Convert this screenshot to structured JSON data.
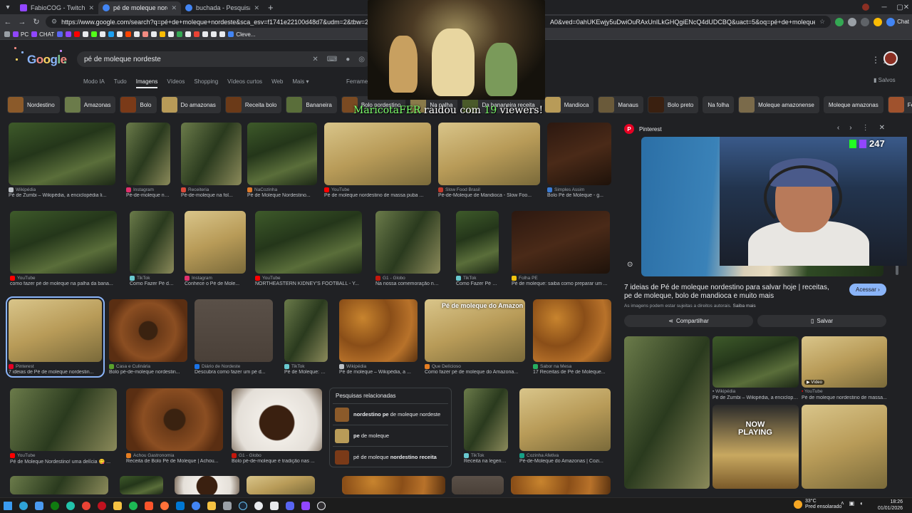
{
  "browser": {
    "tabs": [
      {
        "label": "FabioCOG - Twitch",
        "color": "#9146ff",
        "active": false
      },
      {
        "label": "pé de moleque nordeste - Pesqui...",
        "color": "#4285f4",
        "active": true
      },
      {
        "label": "buchada - Pesquisa Google",
        "color": "#4285f4",
        "active": false
      }
    ],
    "url": "https://www.google.com/search?q=pé+de+moleque+nordeste&sca_esv=f1741e22100d48d7&udm=2&tbw=2552&bih=1274&ssrf=AE3TifMY0Cm...",
    "url_tail": "A0&ved=0ahUKEwjy5uDwiOuRAxUnILkGHQgiENcQ4dUDCBQ&uact=5&oq=pé+de+moleque+nordeste&gs_lp=Egtnd3Mt...",
    "chat_label": "Chat",
    "bookmarks": [
      "PC",
      "CHAT",
      "Cleve..."
    ]
  },
  "google": {
    "logo": "Google",
    "query": "pé de moleque nordeste",
    "modes": [
      "Modo IA",
      "Tudo",
      "Imagens",
      "Vídeos",
      "Shopping",
      "Vídeos curtos",
      "Web",
      "Mais"
    ],
    "active_mode": "Imagens",
    "tools": "Ferrame",
    "saved": "Salvos",
    "chips": [
      {
        "label": "Nordestino",
        "color": "#8b5a2a"
      },
      {
        "label": "Amazonas",
        "color": "#6b7b4a"
      },
      {
        "label": "Bolo",
        "color": "#7a3a18"
      },
      {
        "label": "Do amazonas",
        "color": "#b89b58"
      },
      {
        "label": "Receita bolo",
        "color": "#6b3a18"
      },
      {
        "label": "Bananeira",
        "color": "#5a6e3a"
      },
      {
        "label": "Bolo nordestino",
        "color": "#7a4a22"
      },
      {
        "label": "Na palha",
        "color": "#8a7a4a"
      },
      {
        "label": "Da bananeira receita",
        "color": "#4a5a2a"
      },
      {
        "label": "Mandioca",
        "color": "#b89b58"
      },
      {
        "label": "Manaus",
        "color": "#6a5a3a"
      },
      {
        "label": "Bolo preto",
        "color": "#3a2010"
      },
      {
        "label": "Na folha",
        "color": null
      },
      {
        "label": "Moleque amazonense",
        "color": "#7a6a4a"
      },
      {
        "label": "Moleque amazonas",
        "color": null
      },
      {
        "label": "Festa jun",
        "color": "#a0522d"
      }
    ]
  },
  "stream": {
    "raid_prefix": "MaricotaFER",
    "raid_mid": " raidou com ",
    "raid_count": "19",
    "raid_suffix": " viewers!",
    "viewer_count": "247",
    "now_playing": "NOW\nPLAYING"
  },
  "results": {
    "row1": [
      {
        "source": "Wikipédia",
        "caption": "Pé de Zumbi – Wikipédia, a enciclopédia li...",
        "style": "leaf",
        "icolor": "#bdc1c6"
      },
      {
        "source": "Instagram",
        "caption": "Pé-de-moleque nor...",
        "style": "leaf2",
        "icolor": "#e1306c"
      },
      {
        "source": "Receiteria",
        "caption": "Pé-de-moleque na fol...",
        "style": "leaf2",
        "icolor": "#d94a3a"
      },
      {
        "source": "NaCozinha",
        "caption": "Pé de Moleque Nordestino...",
        "style": "leaf",
        "icolor": "#e07a2a"
      },
      {
        "source": "YouTube",
        "caption": "Pé de moleque nordestino de massa puba ...",
        "style": "pale",
        "icolor": "#ff0000"
      },
      {
        "source": "Slow Food Brasil",
        "caption": "Pé-de-Moleque de Mandioca - Slow Foo...",
        "style": "pale",
        "icolor": "#c0392b"
      },
      {
        "source": "Simples Assim",
        "caption": "Bolo Pé de Moleque - g...",
        "style": "brownie",
        "icolor": "#3a7bd5"
      }
    ],
    "row2": [
      {
        "source": "YouTube",
        "caption": "como fazer pé de moleque na palha da bana...",
        "style": "leaf",
        "icolor": "#ff0000"
      },
      {
        "source": "TikTok",
        "caption": "Como Fazer Pé de...",
        "style": "leaf2",
        "icolor": "#69c9d0"
      },
      {
        "source": "Instagram",
        "caption": "Conhece o Pé de Mole...",
        "style": "pale",
        "icolor": "#e1306c"
      },
      {
        "source": "YouTube",
        "caption": "NORTHEASTERN KIDNEY'S FOOTBALL - Y...",
        "style": "leaf",
        "icolor": "#ff0000"
      },
      {
        "source": "G1 - Globo",
        "caption": "Na nossa comemoração nã...",
        "style": "leaf2",
        "icolor": "#c4170c"
      },
      {
        "source": "TikTok",
        "caption": "Como Fazer Pé de...",
        "style": "leaf",
        "icolor": "#69c9d0"
      },
      {
        "source": "Folha PE",
        "caption": "Pé de moleque: saiba como preparar um ...",
        "style": "brownie",
        "icolor": "#f1c40f"
      }
    ],
    "row3": [
      {
        "source": "Pinterest",
        "caption": "7 ideias de Pé de moleque nordestin...",
        "style": "pale",
        "icolor": "#e60023",
        "selected": true
      },
      {
        "source": "Casa e Culinária",
        "caption": "Bolo pé-de-moleque nordestin...",
        "style": "cake",
        "icolor": "#5aa02c"
      },
      {
        "source": "Diário de Nordeste",
        "caption": "Descubra como fazer um pé d...",
        "style": "grey",
        "icolor": "#1a73e8"
      },
      {
        "source": "TikTok",
        "caption": "Pé de Moleque: R...",
        "style": "leaf2",
        "icolor": "#69c9d0"
      },
      {
        "source": "Wikipédia",
        "caption": "Pé de moleque – Wikipédia, a ...",
        "style": "nuts",
        "icolor": "#bdc1c6"
      },
      {
        "source": "Que Delícioso",
        "caption": "Como fazer pé de moleque do Amazona...",
        "style": "pale",
        "icolor": "#e67e22",
        "overlay": "Pé de moleque do Amazon"
      },
      {
        "source": "Sabor na Mesa",
        "caption": "17 Receitas de Pé de Moleque...",
        "style": "nuts",
        "icolor": "#27ae60"
      }
    ],
    "row4": [
      {
        "source": "YouTube",
        "caption": "Pé de Moleque Nordestino! uma delícia 😋 ...",
        "style": "leaf2",
        "icolor": "#ff0000"
      },
      {
        "source": "Achou Gastronomia",
        "caption": "Receita de Bolo Pé de Moleque | Achou...",
        "style": "cake",
        "icolor": "#e67e22"
      },
      {
        "source": "G1 - Globo",
        "caption": "Bolo pé-de-moleque é tradição nas ...",
        "style": "plate",
        "icolor": "#c4170c"
      },
      {
        "source": "TikTok",
        "caption": "Receita na legend...",
        "style": "leaf2",
        "icolor": "#69c9d0"
      },
      {
        "source": "Cozinha Afetiva",
        "caption": "Pé-de-Moleque do Amazonas | Cozi...",
        "style": "pale",
        "icolor": "#16a085"
      }
    ],
    "related": {
      "heading": "Pesquisas relacionadas",
      "items": [
        {
          "bold": "nordestino pe",
          "rest": " de moleque nordeste",
          "color": "#8b5a2a"
        },
        {
          "bold": "pe",
          "rest": " de moleque",
          "color": "#b89b58"
        },
        {
          "bold": "",
          "rest": "pé de moleque nordestino receita",
          "color": "#7a3a18",
          "bold_tail": "nordestino receita"
        }
      ]
    }
  },
  "panel": {
    "source": "Pinterest",
    "title": "7 ideias de Pé de moleque nordestino para salvar hoje | receitas, pe de moleque, bolo de mandioca e muito mais",
    "visit": "Acessar",
    "note": "As imagens podem estar sujeitas a direitos autorais.",
    "note_link": "Saiba mais",
    "share": "Compartilhar",
    "save": "Salvar",
    "related": [
      {
        "source": "Wikipédia",
        "caption": "Pé de Zumbi – Wikipédia, a enciclopédi...",
        "icolor": "#bdc1c6"
      },
      {
        "source": "YouTube",
        "caption": "Pé de moleque nordestino de massa...",
        "icolor": "#ff0000",
        "badge": "Vídeo"
      }
    ]
  },
  "taskbar": {
    "weather_temp": "33°C",
    "weather_desc": "Pred ensolarado",
    "time": "18:26",
    "date": "01/01/2026"
  }
}
